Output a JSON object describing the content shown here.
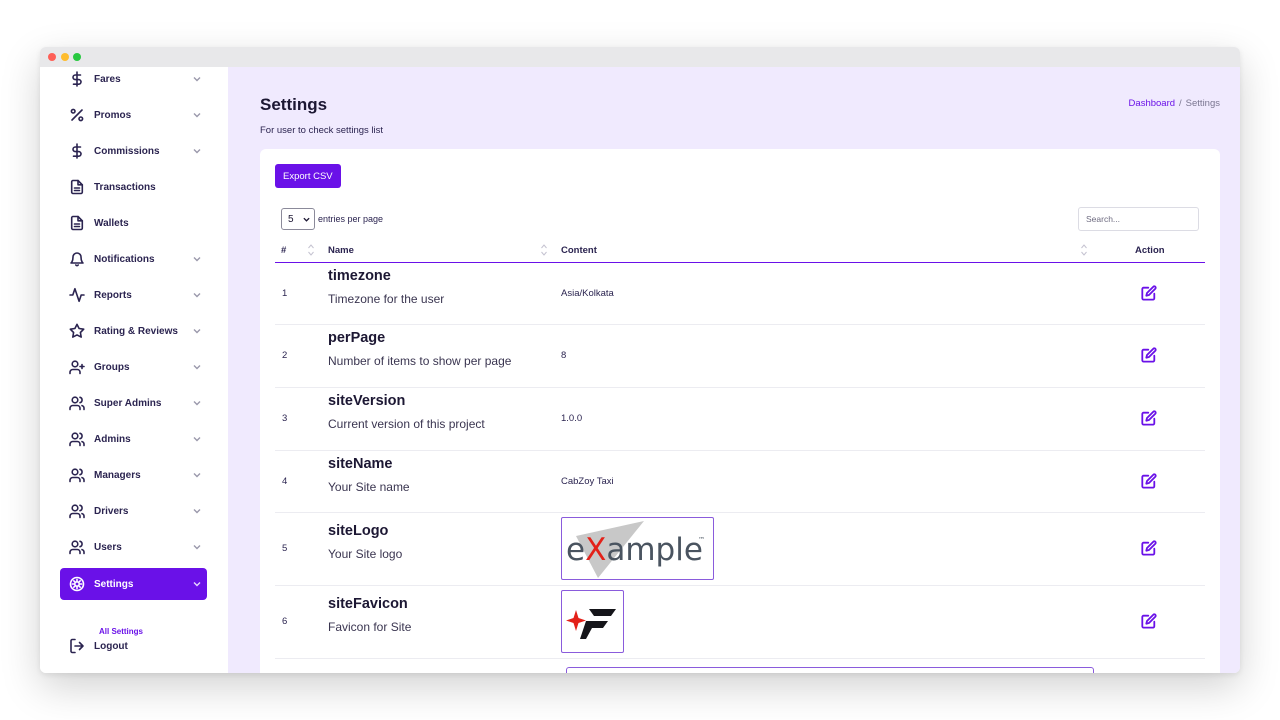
{
  "sidebar": {
    "items": [
      {
        "label": "Fares",
        "icon": "dollar-icon",
        "has_chevron": true
      },
      {
        "label": "Promos",
        "icon": "percent-icon",
        "has_chevron": true
      },
      {
        "label": "Commissions",
        "icon": "dollar-icon",
        "has_chevron": true
      },
      {
        "label": "Transactions",
        "icon": "file-icon",
        "has_chevron": false
      },
      {
        "label": "Wallets",
        "icon": "file-icon",
        "has_chevron": false
      },
      {
        "label": "Notifications",
        "icon": "bell-icon",
        "has_chevron": true
      },
      {
        "label": "Reports",
        "icon": "activity-icon",
        "has_chevron": true
      },
      {
        "label": "Rating & Reviews",
        "icon": "star-icon",
        "has_chevron": true
      },
      {
        "label": "Groups",
        "icon": "user-plus-icon",
        "has_chevron": true
      },
      {
        "label": "Super Admins",
        "icon": "users-icon",
        "has_chevron": true
      },
      {
        "label": "Admins",
        "icon": "users-icon",
        "has_chevron": true
      },
      {
        "label": "Managers",
        "icon": "users-icon",
        "has_chevron": true
      },
      {
        "label": "Drivers",
        "icon": "users-icon",
        "has_chevron": true
      },
      {
        "label": "Users",
        "icon": "users-icon",
        "has_chevron": true
      },
      {
        "label": "Settings",
        "icon": "gear-icon",
        "has_chevron": true,
        "active": true
      },
      {
        "label": "Logout",
        "icon": "logout-icon",
        "has_chevron": false
      }
    ],
    "sub_item": "All Settings"
  },
  "header": {
    "title": "Settings",
    "subtitle": "For user to check settings list",
    "breadcrumb": {
      "home": "Dashboard",
      "separator": "/",
      "current": "Settings"
    }
  },
  "toolbar": {
    "export_label": "Export CSV",
    "per_page_value": "5",
    "per_page_label": "entries per page",
    "search_placeholder": "Search..."
  },
  "table": {
    "columns": [
      "#",
      "Name",
      "Content",
      "Action"
    ],
    "rows": [
      {
        "num": "1",
        "key": "timezone",
        "desc": "Timezone for the user",
        "content": "Asia/Kolkata"
      },
      {
        "num": "2",
        "key": "perPage",
        "desc": "Number of items to show per page",
        "content": "8"
      },
      {
        "num": "3",
        "key": "siteVersion",
        "desc": "Current version of this project",
        "content": "1.0.0"
      },
      {
        "num": "4",
        "key": "siteName",
        "desc": "Your Site name",
        "content": "CabZoy Taxi"
      },
      {
        "num": "5",
        "key": "siteLogo",
        "desc": "Your Site logo",
        "content": ""
      },
      {
        "num": "6",
        "key": "siteFavicon",
        "desc": "Favicon for Site",
        "content": ""
      }
    ]
  },
  "logo": {
    "text_e": "e",
    "text_x": "X",
    "text_rest": "ample",
    "tm": "™"
  },
  "colors": {
    "accent": "#6a11e8",
    "background": "#f0eafe",
    "logo_red": "#e32119"
  }
}
